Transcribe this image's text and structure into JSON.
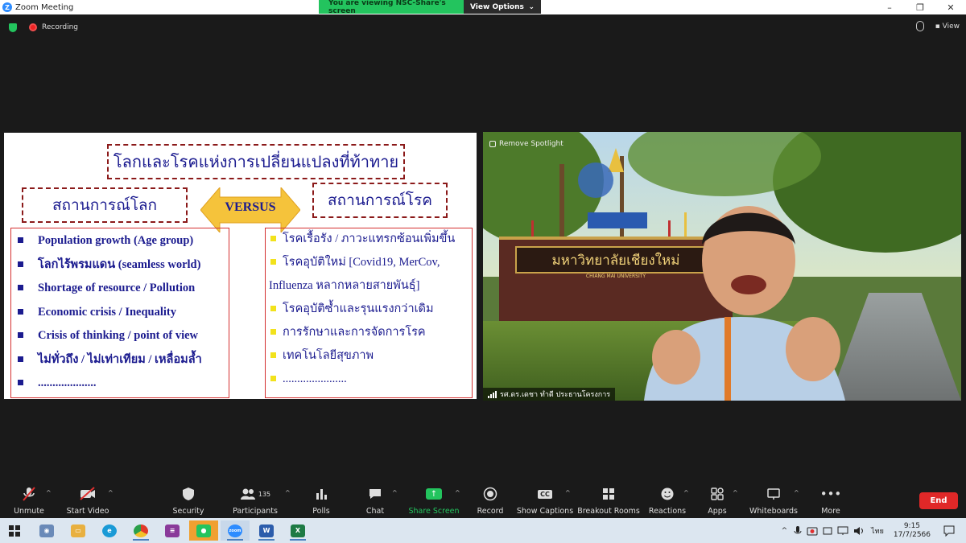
{
  "window": {
    "title": "Zoom Meeting",
    "minimize": "–",
    "maximize": "❐",
    "close": "✕"
  },
  "share_banner": {
    "message": "You are viewing NSC-Share's screen",
    "view_options": "View Options",
    "caret": "⌄"
  },
  "info_bar": {
    "recording_label": "Recording",
    "view_label": "View",
    "view_icon": "▪"
  },
  "slide": {
    "title": "โลกและโรคแห่งการเปลี่ยนแปลงที่ท้าทาย",
    "left_heading": "สถานการณ์โลก",
    "right_heading": "สถานการณ์โรค",
    "versus": "VERSUS",
    "left_items": [
      "Population growth (Age group)",
      "โลกไร้พรมแดน (seamless world)",
      "Shortage of resource / Pollution",
      "Economic crisis / Inequality",
      "Crisis of thinking / point of view",
      "ไม่ทั่วถึง / ไม่เท่าเทียม / เหลื่อมล้ำ",
      "...................."
    ],
    "right_items": [
      "โรคเรื้อรัง / ภาวะแทรกซ้อนเพิ่มขึ้น",
      "โรคอุบัติใหม่ [Covid19, MerCov,",
      "Influenza หลากหลายสายพันธุ์]",
      "โรคอุบัติซ้ำและรุนแรงกว่าเดิม",
      "การรักษาและการจัดการโรค",
      "เทคโนโลยีสุขภาพ",
      "......................"
    ]
  },
  "video": {
    "spotlight_label": "Remove Spotlight",
    "sign_text": "มหาวิทยาลัยเชียงใหม่",
    "sign_sub": "CHIANG MAI UNIVERSITY",
    "participant_name": "รศ.ดร.เดชา ทำดี ประธานโครงการ"
  },
  "toolbar": {
    "unmute": "Unmute",
    "start_video": "Start Video",
    "security": "Security",
    "participants": "Participants",
    "participants_count": "135",
    "polls": "Polls",
    "chat": "Chat",
    "share_screen": "Share Screen",
    "record": "Record",
    "show_captions": "Show Captions",
    "cc_icon": "CC",
    "breakout_rooms": "Breakout Rooms",
    "reactions": "Reactions",
    "apps": "Apps",
    "whiteboards": "Whiteboards",
    "more": "More",
    "more_icon": "•••",
    "end": "End",
    "caret": "^"
  },
  "taskbar": {
    "zoom_label": "zoom",
    "word_label": "W",
    "excel_label": "X",
    "tray_up": "^",
    "language": "ไทย",
    "time": "9:15",
    "date": "17/7/2566"
  },
  "colors": {
    "zoom_blue": "#2d8cff",
    "share_green": "#23c45e",
    "end_red": "#e02828",
    "slide_text": "#1b1b8f",
    "slide_border": "#d43030"
  }
}
